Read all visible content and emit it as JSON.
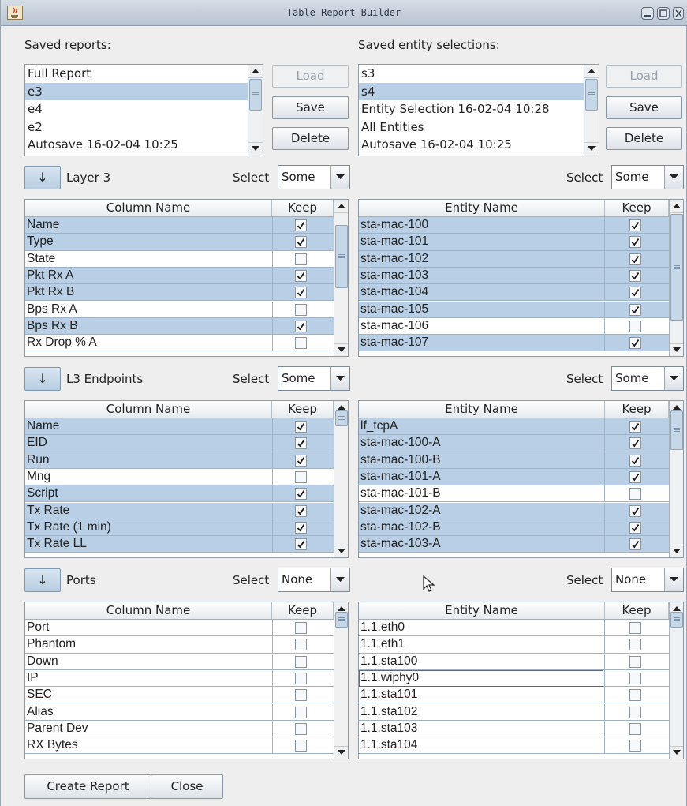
{
  "window": {
    "title": "Table Report Builder",
    "minimize": "minimize",
    "maximize": "maximize",
    "close": "close"
  },
  "saved_reports": {
    "label": "Saved reports:",
    "items": [
      {
        "text": "Full Report",
        "selected": false
      },
      {
        "text": "e3",
        "selected": true
      },
      {
        "text": "e4",
        "selected": false
      },
      {
        "text": "e2",
        "selected": false
      },
      {
        "text": "Autosave 16-02-04 10:25",
        "selected": false
      }
    ],
    "load": "Load",
    "save": "Save",
    "delete": "Delete"
  },
  "saved_entities": {
    "label": "Saved entity selections:",
    "items": [
      {
        "text": "s3",
        "selected": false
      },
      {
        "text": "s4",
        "selected": true
      },
      {
        "text": "Entity Selection 16-02-04 10:28",
        "selected": false
      },
      {
        "text": "All Entities",
        "selected": false
      },
      {
        "text": "Autosave 16-02-04 10:25",
        "selected": false
      }
    ],
    "load": "Load",
    "save": "Save",
    "delete": "Delete"
  },
  "sections": [
    {
      "arrow": "↓",
      "name": "Layer 3",
      "select_label_left": "Select",
      "select_value_left": "Some",
      "select_label_right": "Select",
      "select_value_right": "Some",
      "col_header": "Column Name",
      "keep_header": "Keep",
      "entity_header": "Entity Name",
      "columns": [
        {
          "name": "Name",
          "keep": true
        },
        {
          "name": "Type",
          "keep": true
        },
        {
          "name": "State",
          "keep": false
        },
        {
          "name": "Pkt Rx A",
          "keep": true
        },
        {
          "name": "Pkt Rx B",
          "keep": true
        },
        {
          "name": "Bps Rx A",
          "keep": false
        },
        {
          "name": "Bps Rx B",
          "keep": true
        },
        {
          "name": "Rx Drop % A",
          "keep": false
        }
      ],
      "entities": [
        {
          "name": "sta-mac-100",
          "keep": true
        },
        {
          "name": "sta-mac-101",
          "keep": true
        },
        {
          "name": "sta-mac-102",
          "keep": true
        },
        {
          "name": "sta-mac-103",
          "keep": true
        },
        {
          "name": "sta-mac-104",
          "keep": true
        },
        {
          "name": "sta-mac-105",
          "keep": true
        },
        {
          "name": "sta-mac-106",
          "keep": false
        },
        {
          "name": "sta-mac-107",
          "keep": true
        }
      ]
    },
    {
      "arrow": "↓",
      "name": "L3 Endpoints",
      "select_label_left": "Select",
      "select_value_left": "Some",
      "select_label_right": "Select",
      "select_value_right": "Some",
      "col_header": "Column Name",
      "keep_header": "Keep",
      "entity_header": "Entity Name",
      "columns": [
        {
          "name": "Name",
          "keep": true
        },
        {
          "name": "EID",
          "keep": true
        },
        {
          "name": "Run",
          "keep": true
        },
        {
          "name": "Mng",
          "keep": false
        },
        {
          "name": "Script",
          "keep": true
        },
        {
          "name": "Tx Rate",
          "keep": true
        },
        {
          "name": "Tx Rate (1 min)",
          "keep": true
        },
        {
          "name": "Tx Rate LL",
          "keep": true
        }
      ],
      "entities": [
        {
          "name": "lf_tcpA",
          "keep": true
        },
        {
          "name": "sta-mac-100-A",
          "keep": true
        },
        {
          "name": "sta-mac-100-B",
          "keep": true
        },
        {
          "name": "sta-mac-101-A",
          "keep": true
        },
        {
          "name": "sta-mac-101-B",
          "keep": false
        },
        {
          "name": "sta-mac-102-A",
          "keep": true
        },
        {
          "name": "sta-mac-102-B",
          "keep": true
        },
        {
          "name": "sta-mac-103-A",
          "keep": true
        }
      ]
    },
    {
      "arrow": "↓",
      "name": "Ports",
      "select_label_left": "Select",
      "select_value_left": "None",
      "select_label_right": "Select",
      "select_value_right": "None",
      "col_header": "Column Name",
      "keep_header": "Keep",
      "entity_header": "Entity Name",
      "columns": [
        {
          "name": "Port",
          "keep": false
        },
        {
          "name": "Phantom",
          "keep": false
        },
        {
          "name": "Down",
          "keep": false
        },
        {
          "name": "IP",
          "keep": false
        },
        {
          "name": "SEC",
          "keep": false
        },
        {
          "name": "Alias",
          "keep": false
        },
        {
          "name": "Parent Dev",
          "keep": false
        },
        {
          "name": "RX Bytes",
          "keep": false
        }
      ],
      "entities": [
        {
          "name": "1.1.eth0",
          "keep": false
        },
        {
          "name": "1.1.eth1",
          "keep": false
        },
        {
          "name": "1.1.sta100",
          "keep": false
        },
        {
          "name": "1.1.wiphy0",
          "keep": false
        },
        {
          "name": "1.1.sta101",
          "keep": false
        },
        {
          "name": "1.1.sta102",
          "keep": false
        },
        {
          "name": "1.1.sta103",
          "keep": false
        },
        {
          "name": "1.1.sta104",
          "keep": false
        }
      ]
    }
  ],
  "footer": {
    "create_report": "Create Report",
    "close": "Close"
  },
  "colors": {
    "selection": "#b8cfe5",
    "titlebar": "#c8d1dc"
  }
}
